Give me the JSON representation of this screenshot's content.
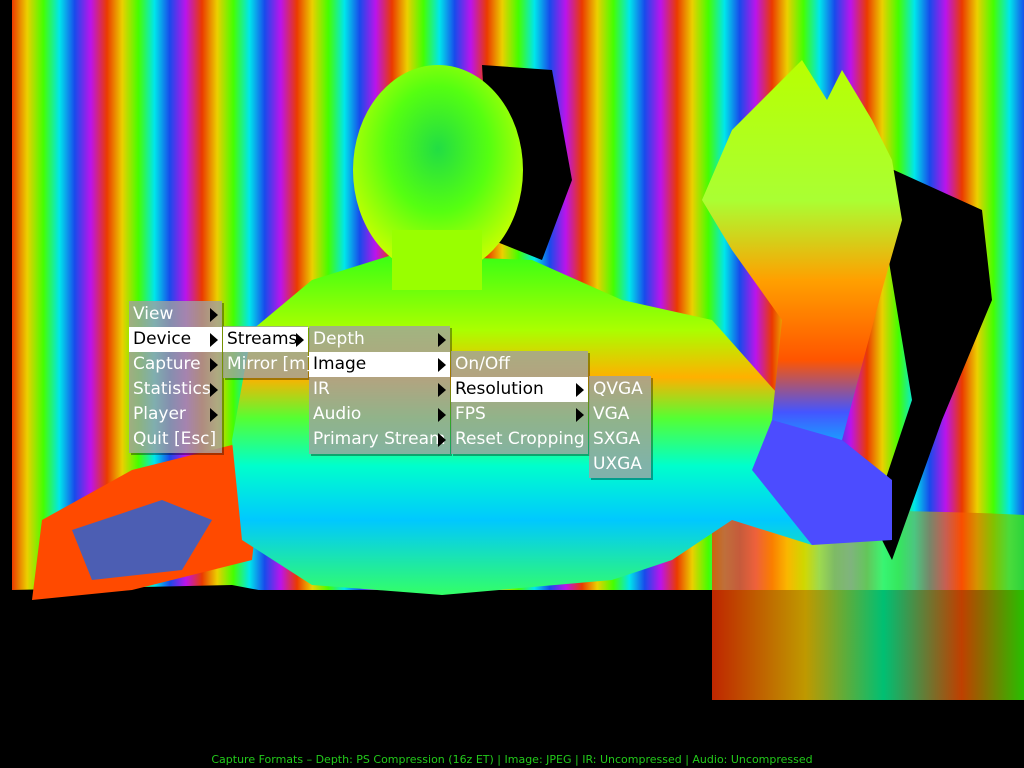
{
  "colors": {
    "menu_bg": "#a0a0a0",
    "menu_text": "#ffffff",
    "selected_bg": "#ffffff",
    "selected_text": "#000000",
    "status_text": "#22c91a"
  },
  "menus": {
    "main": [
      {
        "label": "View",
        "submenu": true
      },
      {
        "label": "Device",
        "submenu": true,
        "selected": true
      },
      {
        "label": "Capture",
        "submenu": true
      },
      {
        "label": "Statistics",
        "submenu": true
      },
      {
        "label": "Player",
        "submenu": true
      },
      {
        "label": "Quit [Esc]",
        "submenu": false
      }
    ],
    "device": [
      {
        "label": "Streams",
        "submenu": true,
        "selected": true
      },
      {
        "label": "Mirror [m]",
        "submenu": false
      }
    ],
    "streams": [
      {
        "label": "Depth",
        "submenu": true
      },
      {
        "label": "Image",
        "submenu": true,
        "selected": true
      },
      {
        "label": "IR",
        "submenu": true
      },
      {
        "label": "Audio",
        "submenu": true
      },
      {
        "label": "Primary Stream",
        "submenu": true
      }
    ],
    "image": [
      {
        "label": "On/Off",
        "submenu": false
      },
      {
        "label": "Resolution",
        "submenu": true,
        "selected": true
      },
      {
        "label": "FPS",
        "submenu": true
      },
      {
        "label": "Reset Cropping",
        "submenu": false
      }
    ],
    "resolution": [
      {
        "label": "QVGA",
        "submenu": false
      },
      {
        "label": "VGA",
        "submenu": false
      },
      {
        "label": "SXGA",
        "submenu": false
      },
      {
        "label": "UXGA",
        "submenu": false
      }
    ]
  },
  "status_bar": "Capture Formats – Depth: PS Compression (16z ET) | Image: JPEG | IR: Uncompressed | Audio: Uncompressed"
}
